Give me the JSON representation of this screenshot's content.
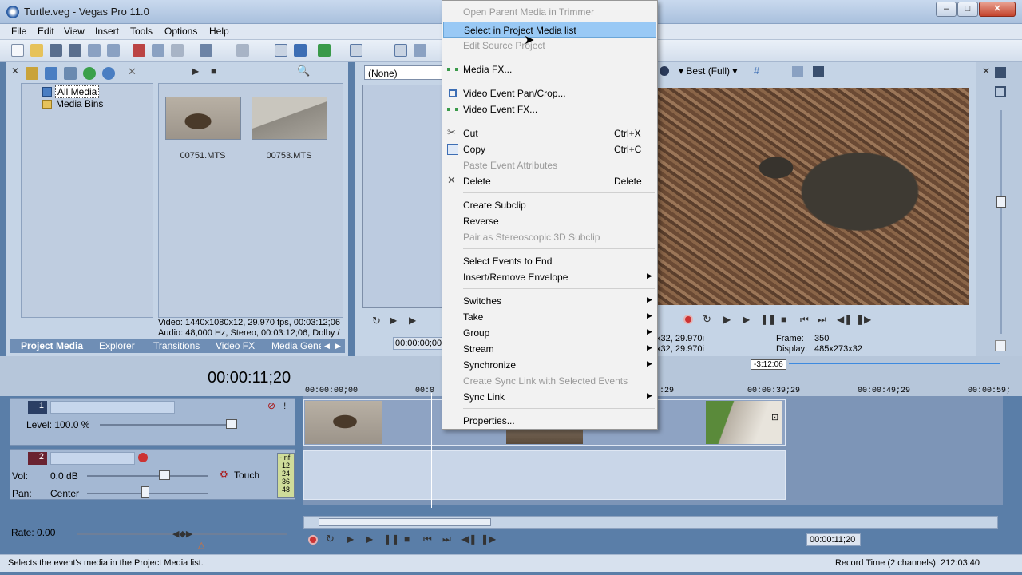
{
  "window": {
    "title": "Turtle.veg - Vegas Pro 11.0",
    "min": "–",
    "max": "□",
    "close": "✕"
  },
  "menubar": [
    "File",
    "Edit",
    "View",
    "Insert",
    "Tools",
    "Options",
    "Help"
  ],
  "project_media": {
    "tree": [
      "All Media",
      "Media Bins"
    ],
    "thumbs": [
      {
        "name": "00751.MTS"
      },
      {
        "name": "00753.MTS"
      }
    ],
    "info_video": "Video: 1440x1080x12, 29.970 fps, 00:03:12;06",
    "info_audio": "Audio: 48,000 Hz, Stereo, 00:03:12;06, Dolby /",
    "tabs": [
      "Project Media",
      "Explorer",
      "Transitions",
      "Video FX",
      "Media Gene"
    ]
  },
  "trimmer": {
    "dropdown": "(None)",
    "timecode": "00:00:00;00"
  },
  "preview": {
    "quality": "Best (Full)",
    "info_left_1": "x32, 29.970i",
    "info_left_2": "x32, 29.970i",
    "frame_label": "Frame:",
    "frame_value": "350",
    "display_label": "Display:",
    "display_value": "485x273x32"
  },
  "timeline": {
    "timecode": "00:00:11;20",
    "marker": "-3:12:06",
    "ruler": [
      "00:00:00;00",
      "00:0",
      ":29",
      "00:00:39;29",
      "00:00:49;29",
      "00:00:59;"
    ],
    "track1": {
      "num": "1",
      "level_label": "Level: 100.0 %"
    },
    "track2": {
      "num": "2",
      "vol_label": "Vol:",
      "vol_value": "0.0 dB",
      "pan_label": "Pan:",
      "pan_value": "Center",
      "mode": "Touch",
      "meter": [
        "-Inf.",
        "12",
        "24",
        "36",
        "48"
      ]
    },
    "rate": "Rate: 0.00",
    "cursor_time": "00:00:11;20"
  },
  "context_menu": {
    "items": [
      {
        "label": "Open Parent Media in Trimmer",
        "disabled": true
      },
      {
        "label": "Select in Project Media list",
        "highlighted": true
      },
      {
        "label": "Edit Source Project",
        "disabled": true
      },
      {
        "label": "Media FX...",
        "icon": "fx-icon"
      },
      {
        "label": "Video Event Pan/Crop...",
        "icon": "pan-crop-icon"
      },
      {
        "label": "Video Event FX...",
        "icon": "fx-icon"
      },
      {
        "label": "Cut",
        "shortcut": "Ctrl+X",
        "icon": "scissors-icon"
      },
      {
        "label": "Copy",
        "shortcut": "Ctrl+C",
        "icon": "copy-icon"
      },
      {
        "label": "Paste Event Attributes",
        "disabled": true
      },
      {
        "label": "Delete",
        "shortcut": "Delete",
        "icon": "delete-icon"
      },
      {
        "label": "Create Subclip"
      },
      {
        "label": "Reverse"
      },
      {
        "label": "Pair as Stereoscopic 3D Subclip",
        "disabled": true
      },
      {
        "label": "Select Events to End"
      },
      {
        "label": "Insert/Remove Envelope",
        "submenu": true
      },
      {
        "label": "Switches",
        "submenu": true
      },
      {
        "label": "Take",
        "submenu": true
      },
      {
        "label": "Group",
        "submenu": true
      },
      {
        "label": "Stream",
        "submenu": true
      },
      {
        "label": "Synchronize",
        "submenu": true
      },
      {
        "label": "Create Sync Link with Selected Events",
        "disabled": true
      },
      {
        "label": "Sync Link",
        "submenu": true
      },
      {
        "label": "Properties..."
      }
    ]
  },
  "status": {
    "text": "Selects the event's media in the Project Media list.",
    "record_time": "Record Time (2 channels): 212:03:40"
  },
  "colors": {
    "accent": "#99c9f5",
    "panel": "#c5d4e6",
    "wave": "#8c2a3a"
  }
}
